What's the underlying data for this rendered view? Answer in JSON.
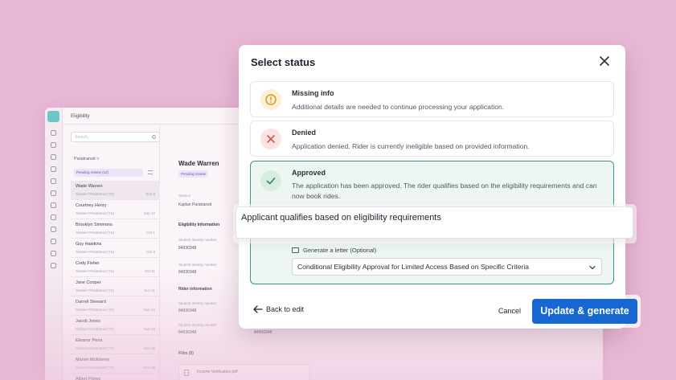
{
  "app": {
    "title": "Eligibility",
    "search_placeholder": "Search...",
    "group_label": "Paratransit",
    "filter_label": "Pending review (12)",
    "rows": [
      {
        "name": "Wade Warren",
        "sub": "Sixteen Paratransit (TS)",
        "date": "Sep 8"
      },
      {
        "name": "Courtney Henry",
        "sub": "Sixteen Paratransit (TS)",
        "date": "Sep 17"
      },
      {
        "name": "Brooklyn Simmons",
        "sub": "Sixteen Paratransit (TS)",
        "date": "Oct 1"
      },
      {
        "name": "Guy Hawkins",
        "sub": "Sixteen Paratransit (TS)",
        "date": "Oct 3"
      },
      {
        "name": "Cody Fisher",
        "sub": "Sixteen Paratransit (TS)",
        "date": "Oct 11"
      },
      {
        "name": "Jane Cooper",
        "sub": "Sixteen Paratransit (TS)",
        "date": "Nov 11"
      },
      {
        "name": "Darrell Steward",
        "sub": "Sixteen Paratransit (TS)",
        "date": "Nov 14"
      },
      {
        "name": "Jacob Jones",
        "sub": "Sixteen Paratransit (TS)",
        "date": "Nov 23"
      },
      {
        "name": "Eleanor Pena",
        "sub": "Sixteen Paratransit (TS)",
        "date": "Nov 26"
      },
      {
        "name": "Marvin McKinney",
        "sub": "Sixteen Paratransit (TS)",
        "date": "Nov 28"
      },
      {
        "name": "Albert Flores",
        "sub": "",
        "date": ""
      }
    ],
    "detail": {
      "name": "Wade Warren",
      "status": "Pending review",
      "service_label": "Service",
      "service_value": "Kaplan Paratransit",
      "section_eligibility": "Eligibility Information",
      "sid_label": "Student identity number",
      "sid_value": "84930348",
      "section_rider": "Rider information",
      "rider_value_2": "84950348",
      "files_label": "Files (5)",
      "file_name": "Income Verification.pdf"
    }
  },
  "modal": {
    "title": "Select status",
    "options": [
      {
        "title": "Missing info",
        "desc": "Additional details are needed to continue processing your application.",
        "color": "#d49a1a"
      },
      {
        "title": "Denied",
        "desc": "Application denied. Rider is currently ineligible based on provided information.",
        "color": "#d9534f"
      },
      {
        "title": "Approved",
        "desc": "The application has been approved. The rider qualifies based on the eligibility requirements and can now book rides.",
        "color": "#2f8a62"
      }
    ],
    "reason_value": "Applicant qualifies based on eligibility requirements",
    "letter_label": "Generate a letter (Optional)",
    "letter_select_value": "Conditional Eligibility Approval for Limited Access Based on Specific Criteria",
    "back_label": "Back to edit",
    "cancel_label": "Cancel",
    "primary_label": "Update & generate",
    "primary_color": "#1767d2"
  }
}
